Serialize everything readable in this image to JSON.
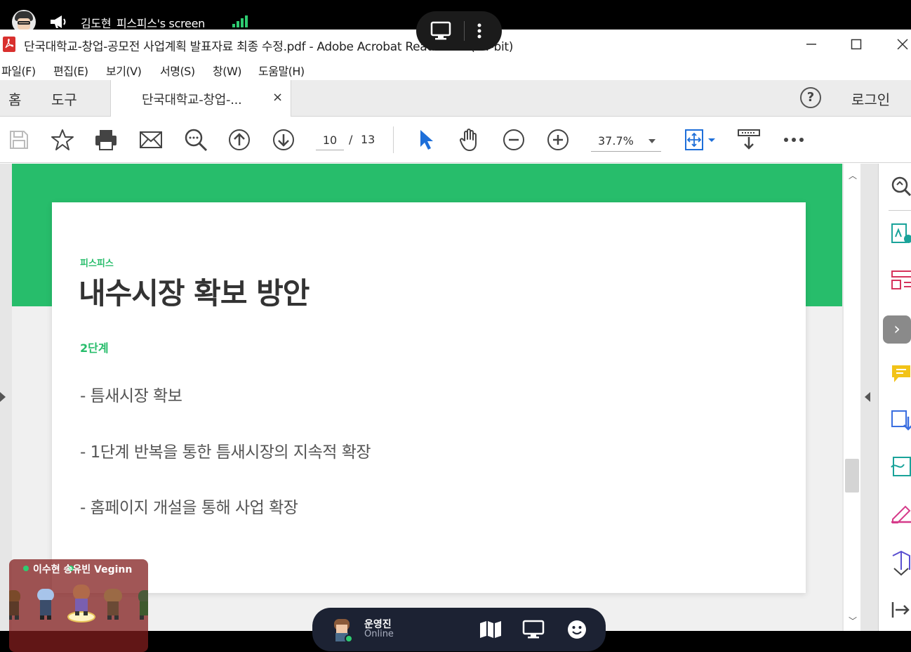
{
  "share": {
    "title": "김도현_피스피스's screen"
  },
  "window": {
    "title": "단국대학교-창업-공모전 사업계획 발표자료 최종 수정.pdf - Adobe Acrobat Reader DC (64-bit)"
  },
  "menu": [
    {
      "label": "파일(F)"
    },
    {
      "label": "편집(E)"
    },
    {
      "label": "보기(V)"
    },
    {
      "label": "서명(S)"
    },
    {
      "label": "창(W)"
    },
    {
      "label": "도움말(H)"
    }
  ],
  "tabs": {
    "home": "홈",
    "tools": "도구",
    "document": "단국대학교-창업-...",
    "close": "×",
    "help": "?",
    "login": "로그인"
  },
  "toolbar": {
    "current_page": "10",
    "separator": "/",
    "total_pages": "13",
    "zoom": "37.7%"
  },
  "slide": {
    "brand": "피스피스",
    "title": "내수시장 확보 방안",
    "step": "2단계",
    "bullets": [
      "- 틈새시장 확보",
      "- 1단계 반복을 통한 틈새시장의 지속적 확장",
      "- 홈페이지 개설을 통해 사업 확장"
    ]
  },
  "participants": {
    "label": "이수현 송유빈 Veginn"
  },
  "player": {
    "name": "운영진",
    "status": "Online"
  },
  "colors": {
    "accent_green": "#27bd6b",
    "status_green": "#2ecc71",
    "player_bar": "#1c2233"
  },
  "icons": {
    "toolbar": [
      "save-icon",
      "bookmark-star-icon",
      "print-icon",
      "email-icon",
      "search-icon",
      "page-up-icon",
      "page-down-icon",
      "select-cursor-icon",
      "hand-icon",
      "zoom-out-icon",
      "zoom-in-icon",
      "fit-page-icon",
      "scroll-mode-icon",
      "more-icon"
    ],
    "right_panel": [
      "search-panel-icon",
      "create-pdf-icon",
      "organize-pages-icon",
      "export-pdf-icon",
      "comment-icon",
      "convert-icon",
      "edit-pdf-icon",
      "fill-sign-icon",
      "protect-icon"
    ],
    "player_bar": [
      "map-icon",
      "screen-share-icon",
      "emoji-icon"
    ]
  }
}
